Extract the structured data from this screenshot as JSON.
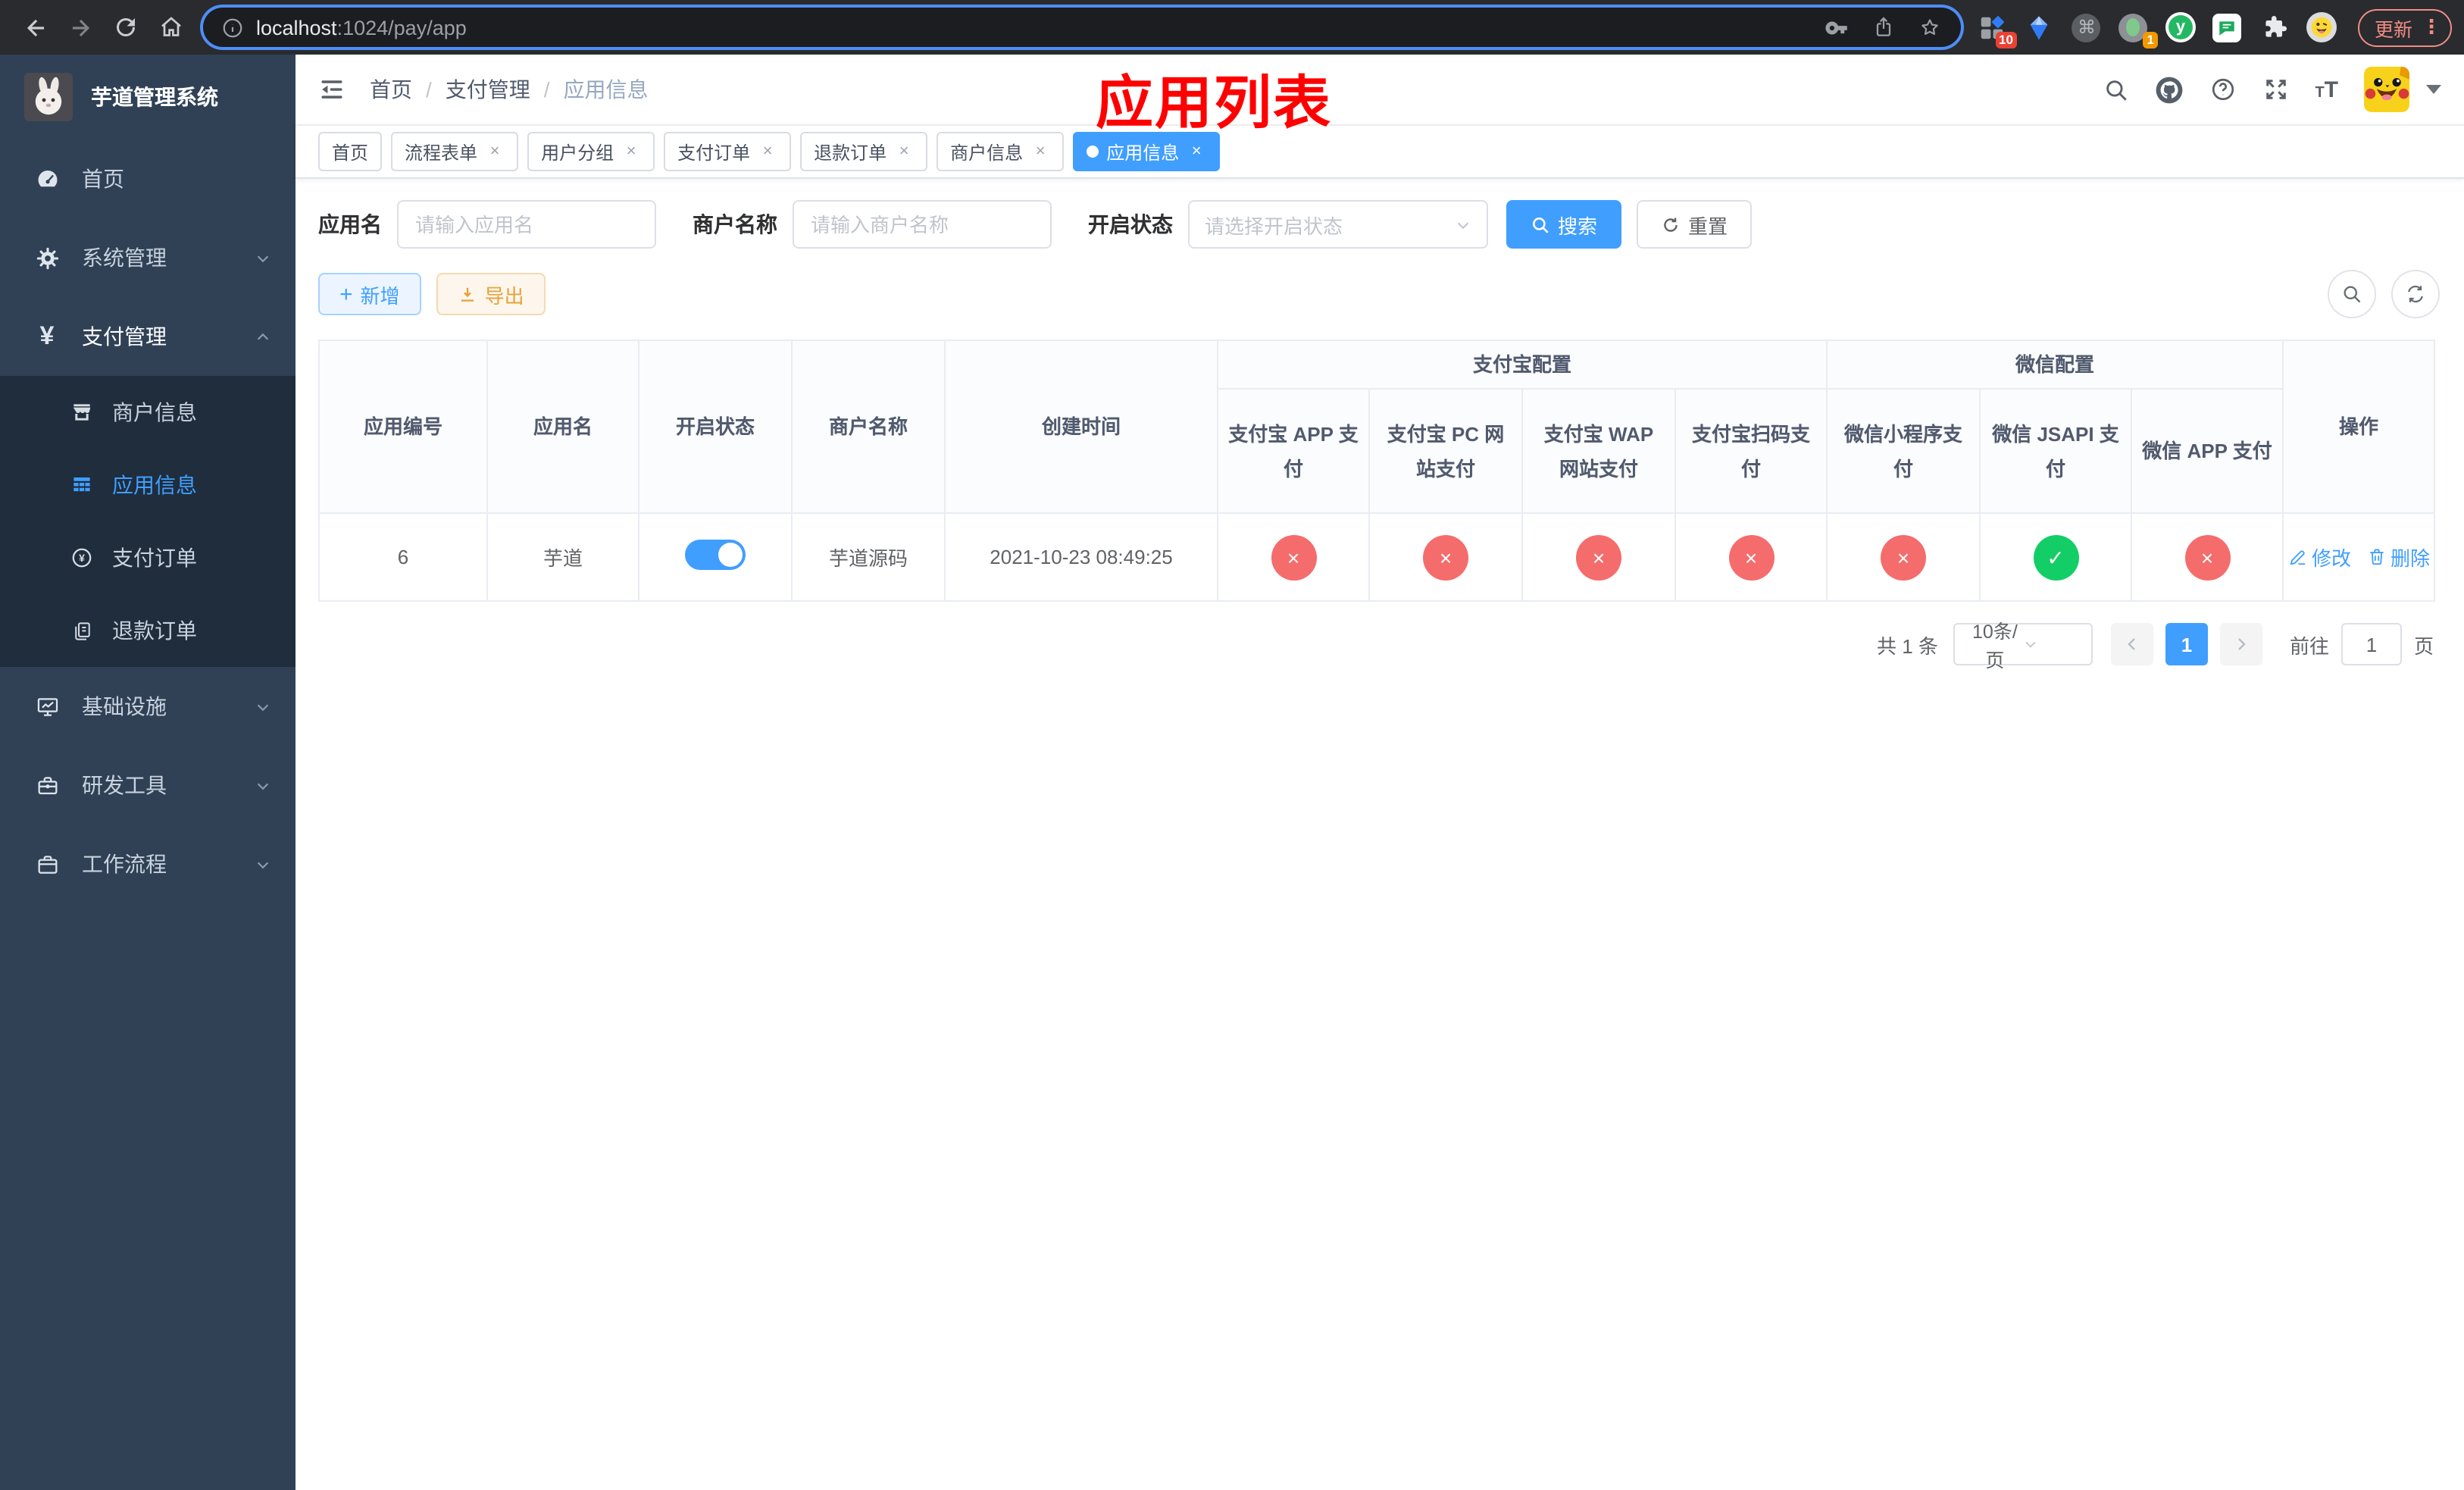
{
  "browser": {
    "url_host": "localhost",
    "url_rest": ":1024/pay/app",
    "update_label": "更新",
    "ext_grid_badge": "10",
    "ext_record_badge": "1",
    "ext_y_letter": "y"
  },
  "icons": {
    "close": "×",
    "star": "☆",
    "cmd": "⌘",
    "dots": "⋮",
    "question": "?",
    "info": "i",
    "plus": "+",
    "font_big": "T",
    "font_small": "T"
  },
  "sidebar": {
    "title": "芋道管理系统",
    "items": [
      {
        "label": "首页"
      },
      {
        "label": "系统管理"
      },
      {
        "label": "支付管理"
      },
      {
        "label": "基础设施"
      },
      {
        "label": "研发工具"
      },
      {
        "label": "工作流程"
      }
    ],
    "submenu": [
      {
        "label": "商户信息"
      },
      {
        "label": "应用信息"
      },
      {
        "label": "支付订单"
      },
      {
        "label": "退款订单"
      }
    ]
  },
  "navbar": {
    "breadcrumb": [
      "首页",
      "支付管理",
      "应用信息"
    ],
    "annotation": "应用列表"
  },
  "tabs": [
    {
      "label": "首页"
    },
    {
      "label": "流程表单"
    },
    {
      "label": "用户分组"
    },
    {
      "label": "支付订单"
    },
    {
      "label": "退款订单"
    },
    {
      "label": "商户信息"
    },
    {
      "label": "应用信息"
    }
  ],
  "search": {
    "app_name_label": "应用名",
    "app_name_placeholder": "请输入应用名",
    "merchant_label": "商户名称",
    "merchant_placeholder": "请输入商户名称",
    "status_label": "开启状态",
    "status_placeholder": "请选择开启状态",
    "search_button": "搜索",
    "reset_button": "重置"
  },
  "actions": {
    "add_button": "新增",
    "export_button": "导出"
  },
  "table": {
    "col_app_id": "应用编号",
    "col_app_name": "应用名",
    "col_status": "开启状态",
    "col_merchant": "商户名称",
    "col_created": "创建时间",
    "group_alipay": "支付宝配置",
    "group_wechat": "微信配置",
    "pay_cols": [
      "支付宝 APP 支付",
      "支付宝 PC 网站支付",
      "支付宝 WAP 网站支付",
      "支付宝扫码支付",
      "微信小程序支付",
      "微信 JSAPI 支付",
      "微信 APP 支付"
    ],
    "col_ops": "操作",
    "row": {
      "app_id": "6",
      "app_name": "芋道",
      "merchant": "芋道源码",
      "created": "2021-10-23 08:49:25",
      "pay_status": [
        "×",
        "×",
        "×",
        "×",
        "×",
        "✓",
        "×"
      ],
      "edit": "修改",
      "delete": "删除"
    }
  },
  "pagination": {
    "total": "共 1 条",
    "page_size": "10条/页",
    "page": "1",
    "goto": "前往",
    "goto_value": "1",
    "page_suffix": "页"
  }
}
